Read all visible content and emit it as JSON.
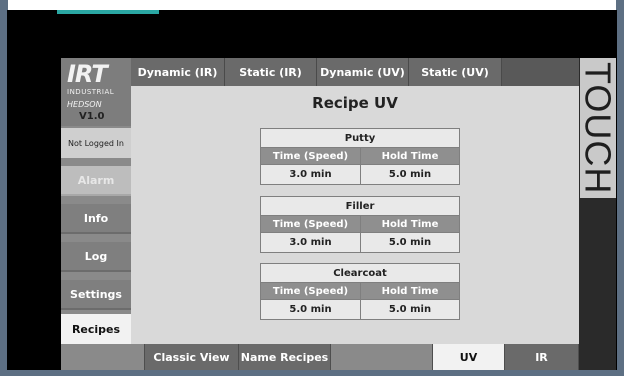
{
  "device": {
    "brand_text": "TOUCH"
  },
  "logo": {
    "brand": "IRT",
    "subtitle": "INDUSTRIAL",
    "partner": "HEDSON",
    "version": "V1.0"
  },
  "status": {
    "login": "Not Logged In"
  },
  "sidebar": {
    "items": [
      {
        "label": "Alarm",
        "state": "disabled"
      },
      {
        "label": "Info",
        "state": "normal"
      },
      {
        "label": "Log",
        "state": "normal"
      },
      {
        "label": "Settings",
        "state": "normal"
      },
      {
        "label": "Recipes",
        "state": "active"
      }
    ]
  },
  "top_tabs": [
    {
      "label": "Dynamic (IR)"
    },
    {
      "label": "Static (IR)"
    },
    {
      "label": "Dynamic (UV)"
    },
    {
      "label": "Static (UV)"
    }
  ],
  "main": {
    "title": "Recipe UV",
    "col_time": "Time (Speed)",
    "col_hold": "Hold Time",
    "recipes": [
      {
        "name": "Putty",
        "time": "3.0 min",
        "hold": "5.0 min"
      },
      {
        "name": "Filler",
        "time": "3.0 min",
        "hold": "5.0 min"
      },
      {
        "name": "Clearcoat",
        "time": "5.0 min",
        "hold": "5.0 min"
      }
    ]
  },
  "bottom_tabs": [
    {
      "label": "Classic View"
    },
    {
      "label": "Name Recipes"
    },
    {
      "label": ""
    },
    {
      "label": "UV",
      "state": "active"
    },
    {
      "label": "IR"
    }
  ],
  "colors": {
    "accent_teal": "#2aa7a3",
    "panel_gray": "#d9d9d9",
    "button_gray": "#7f7f7f",
    "active_tab": "#f2f2f2"
  }
}
